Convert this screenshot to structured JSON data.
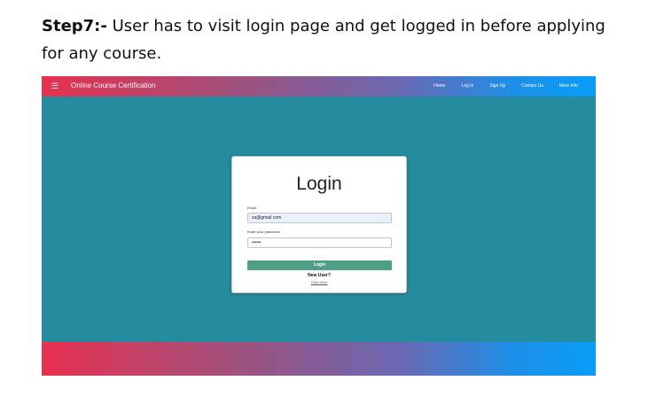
{
  "document": {
    "step_label": "Step7:-",
    "step_text": " User has to visit login page and get logged in before applying for any course."
  },
  "navbar": {
    "menu_icon": "hamburger-icon",
    "brand": "Online Course Certification",
    "links": [
      "Home",
      "Log In",
      "Sign Up",
      "Contact Us",
      "More Info"
    ]
  },
  "login_card": {
    "title": "Login",
    "email_label": "Email",
    "email_value": "sa@gmail.com",
    "password_label": "Enter your password",
    "password_value": "••••••",
    "login_button": "Login",
    "new_user_text": "New User?",
    "click_here_link": "Click Here"
  },
  "colors": {
    "page_background": "#258c9f",
    "gradient_start": "#e8304f",
    "gradient_end": "#099df7",
    "button": "#4f9f87",
    "autofill": "#e8f0fe"
  }
}
